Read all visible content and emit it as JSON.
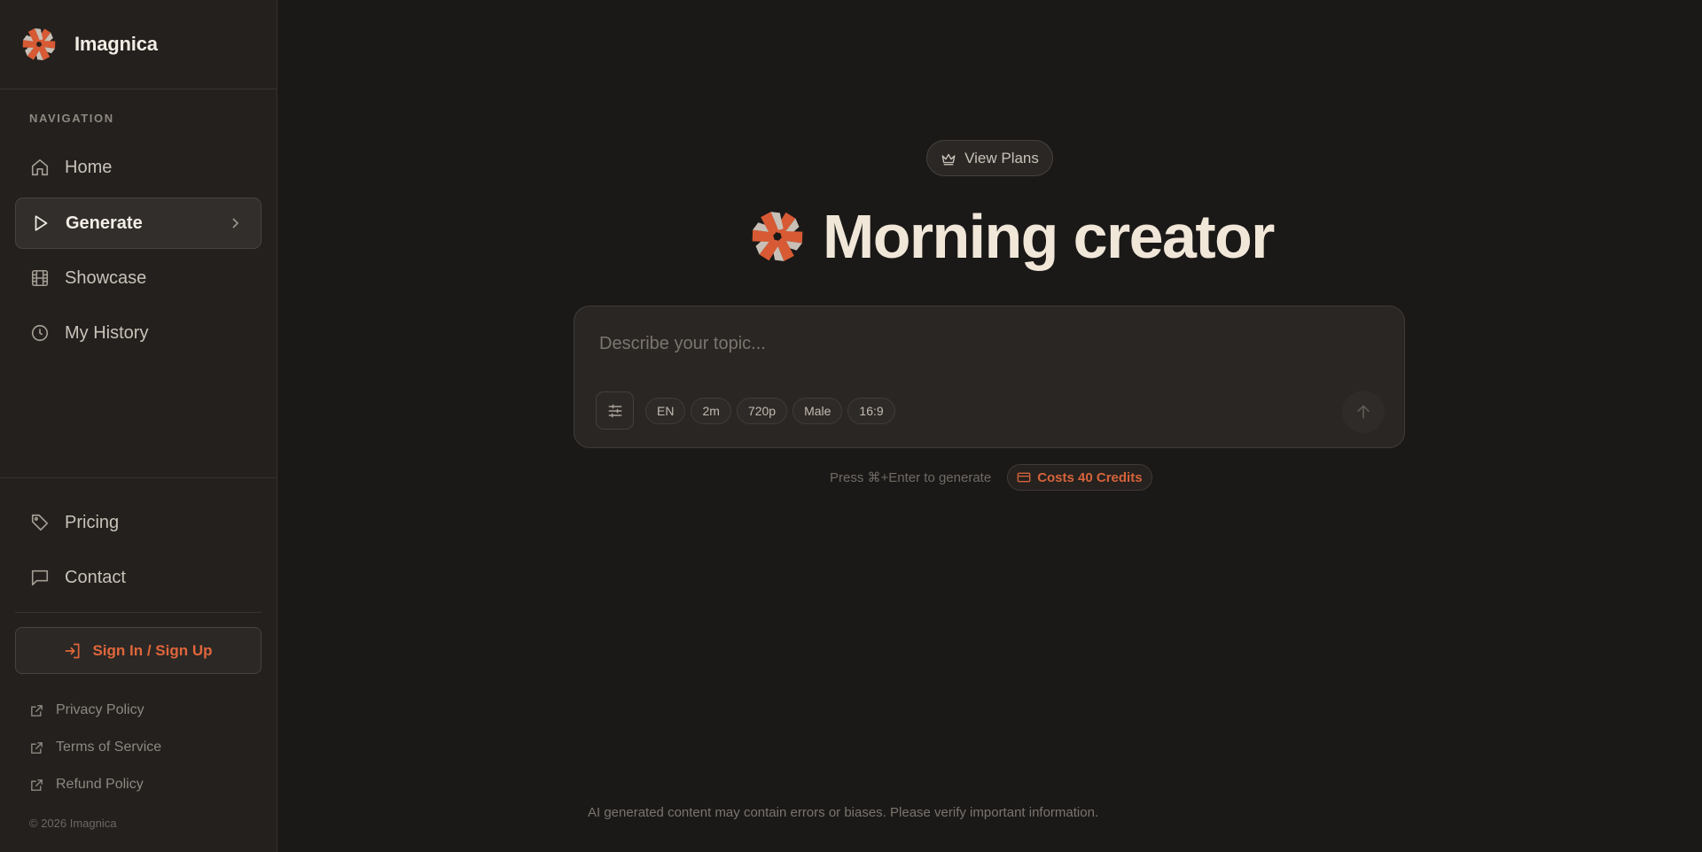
{
  "brand": {
    "name": "Imagnica",
    "logo_icon": "pinwheel-logo-icon"
  },
  "navigation": {
    "heading": "NAVIGATION",
    "items": [
      {
        "label": "Home",
        "icon": "home-icon",
        "active": false
      },
      {
        "label": "Generate",
        "icon": "play-icon",
        "active": true
      },
      {
        "label": "Showcase",
        "icon": "film-icon",
        "active": false
      },
      {
        "label": "My History",
        "icon": "clock-icon",
        "active": false
      }
    ]
  },
  "secondary_nav": {
    "items": [
      {
        "label": "Pricing",
        "icon": "tag-icon"
      },
      {
        "label": "Contact",
        "icon": "message-icon"
      }
    ]
  },
  "auth": {
    "signin_label": "Sign In / Sign Up"
  },
  "footer_links": [
    {
      "label": "Privacy Policy",
      "icon": "external-link-icon"
    },
    {
      "label": "Terms of Service",
      "icon": "external-link-icon"
    },
    {
      "label": "Refund Policy",
      "icon": "external-link-icon"
    }
  ],
  "copyright": "© 2026 Imagnica",
  "main": {
    "view_plans_label": "View Plans",
    "greeting": "Morning creator",
    "prompt": {
      "value": "",
      "placeholder": "Describe your topic...",
      "chips": [
        "EN",
        "2m",
        "720p",
        "Male",
        "16:9"
      ]
    },
    "hint": "Press ⌘+Enter to generate",
    "credits_label": "Costs 40 Credits",
    "disclaimer": "AI generated content may contain errors or biases. Please verify important information."
  },
  "colors": {
    "background": "#1b1918",
    "sidebar": "#23201e",
    "accent": "#e0663b",
    "text_primary": "#f1e7d9"
  }
}
